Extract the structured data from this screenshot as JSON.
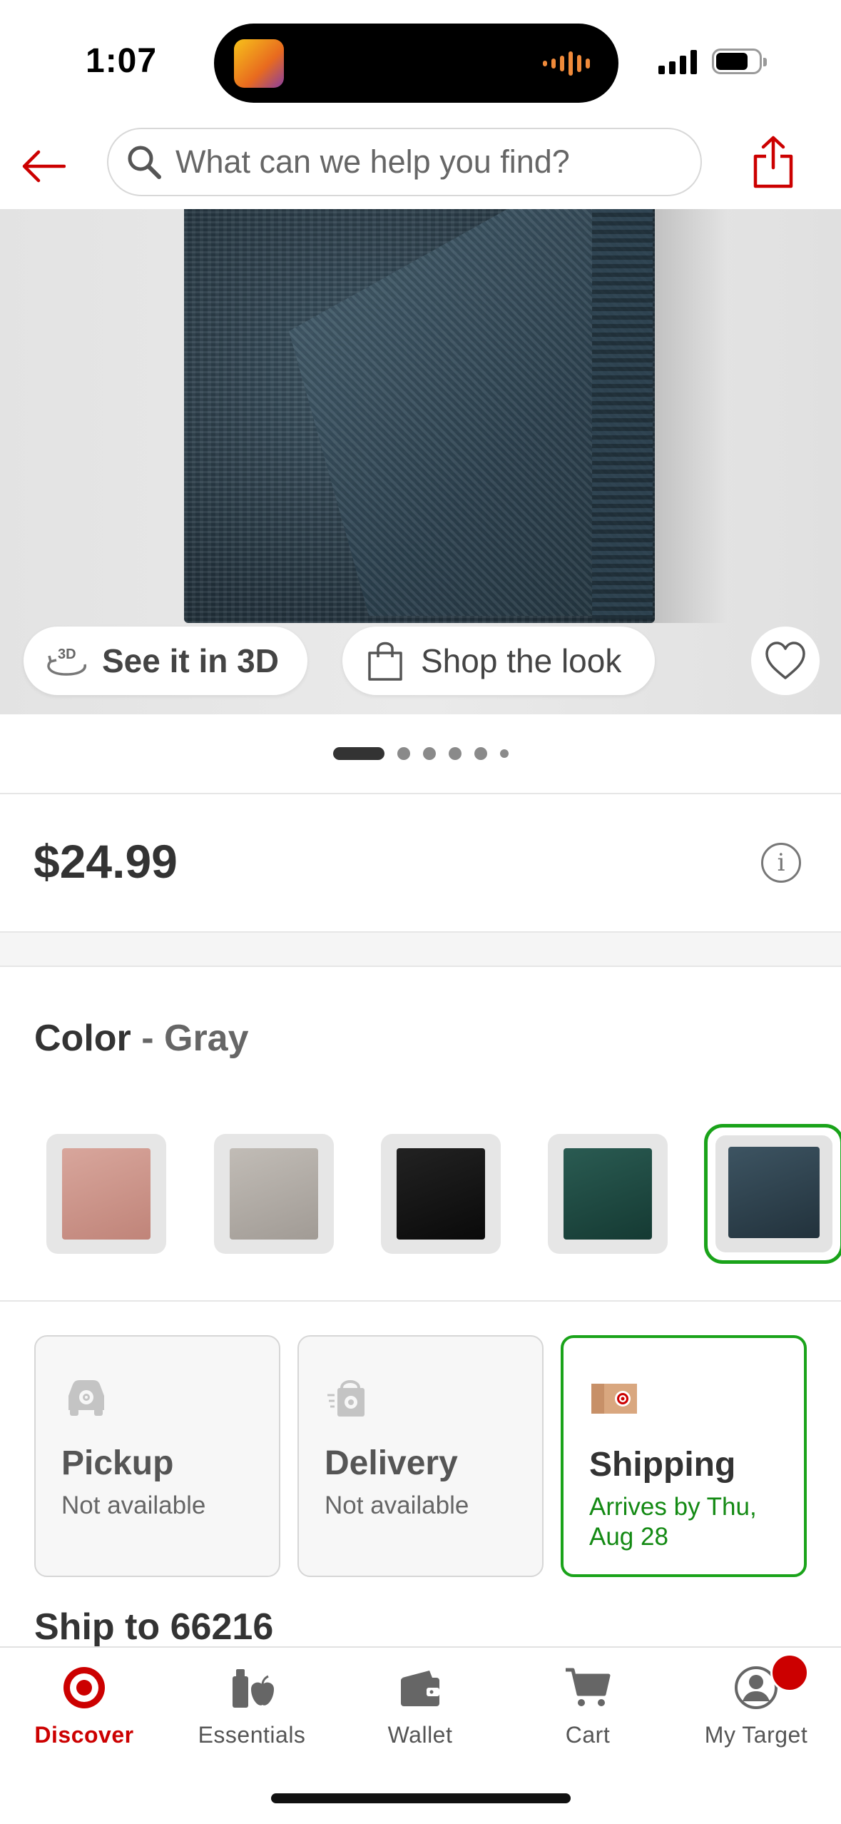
{
  "status_bar": {
    "time": "1:07"
  },
  "header": {
    "search_placeholder": "What can we help you find?",
    "back_icon": "arrow-left-icon",
    "share_icon": "share-icon"
  },
  "hero": {
    "see_3d_label": "See it in 3D",
    "shop_look_label": "Shop the look",
    "favorite_icon": "heart-icon",
    "image_count": 6,
    "active_image": 1
  },
  "product": {
    "price": "$24.99"
  },
  "color": {
    "label": "Color",
    "separator": "-",
    "selected": "Gray",
    "swatches": [
      {
        "name": "Pink",
        "hex": "#c9958b"
      },
      {
        "name": "Light Gray",
        "hex": "#b0aba5"
      },
      {
        "name": "Black",
        "hex": "#151515"
      },
      {
        "name": "Green",
        "hex": "#1d4a42"
      },
      {
        "name": "Gray",
        "hex": "#2c3f4b",
        "selected": true
      }
    ]
  },
  "fulfillment": {
    "options": [
      {
        "title": "Pickup",
        "status": "Not available",
        "icon": "car-icon",
        "selected": false
      },
      {
        "title": "Delivery",
        "status": "Not available",
        "icon": "delivery-bag-icon",
        "selected": false
      },
      {
        "title": "Shipping",
        "status": "Arrives by Thu, Aug 28",
        "icon": "shipping-box-icon",
        "selected": true
      }
    ],
    "ship_to": "Ship to 66216"
  },
  "bottom_nav": {
    "items": [
      {
        "label": "Discover",
        "icon": "target-logo-icon",
        "active": true
      },
      {
        "label": "Essentials",
        "icon": "essentials-icon",
        "active": false
      },
      {
        "label": "Wallet",
        "icon": "wallet-icon",
        "active": false
      },
      {
        "label": "Cart",
        "icon": "cart-icon",
        "active": false
      },
      {
        "label": "My Target",
        "icon": "profile-icon",
        "active": false
      }
    ]
  },
  "colors": {
    "brand_red": "#cc0000",
    "selected_green": "#1aa31a"
  }
}
